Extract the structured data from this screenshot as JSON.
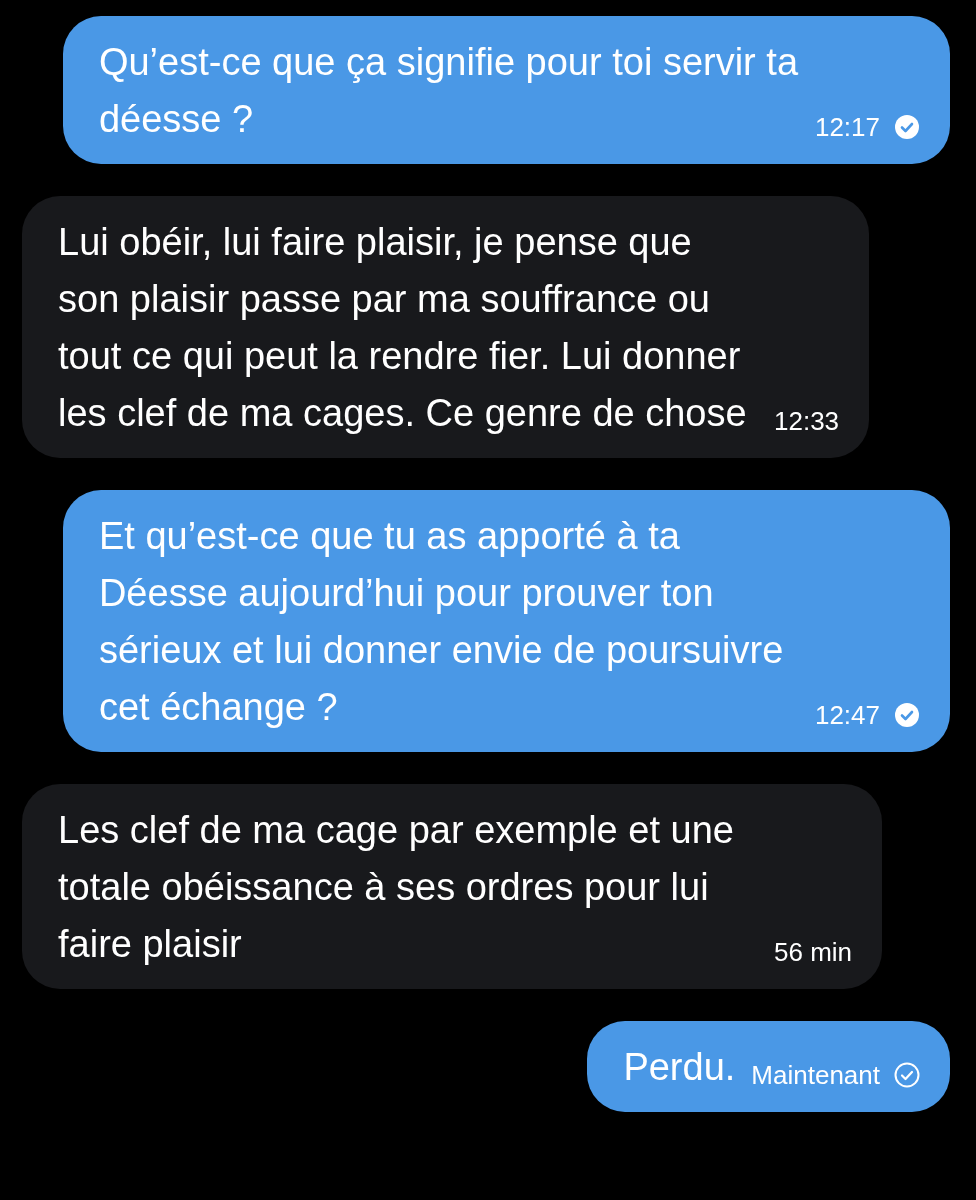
{
  "messages": [
    {
      "kind": "outgoing",
      "text": "Qu’est-ce que ça signifie pour toi servir ta déesse ?",
      "time": "12:17",
      "read": true
    },
    {
      "kind": "incoming",
      "text": "Lui obéir, lui faire plaisir, je pense que son plaisir passe par ma souffrance ou tout ce qui peut la rendre fier. Lui donner les clef de ma cages. Ce genre de chose",
      "time": "12:33"
    },
    {
      "kind": "outgoing",
      "text": "Et qu’est-ce que tu as apporté à ta Déesse aujourd’hui pour prouver ton sérieux et lui donner envie de poursuivre cet échange ?",
      "time": "12:47",
      "read": true
    },
    {
      "kind": "incoming",
      "text": "Les clef de ma cage par exemple et une totale obéissance à ses ordres pour lui faire plaisir",
      "time": "56 min"
    },
    {
      "kind": "outgoing",
      "text": "Perdu.",
      "time": "Maintenant",
      "read": false
    }
  ]
}
